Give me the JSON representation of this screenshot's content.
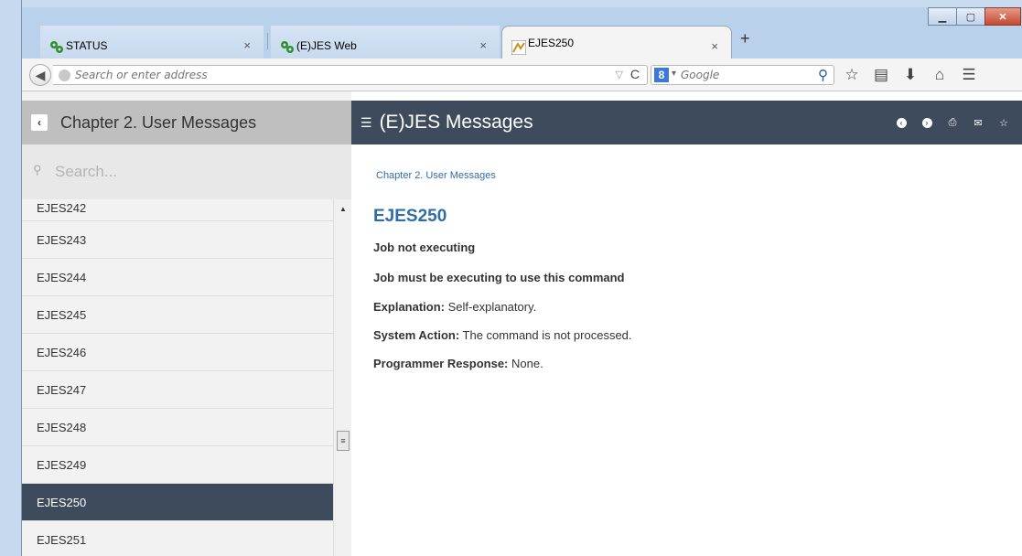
{
  "browser": {
    "tabs": [
      {
        "label": "STATUS",
        "active": false
      },
      {
        "label": "(E)JES Web",
        "active": false
      },
      {
        "label": "EJES250",
        "active": true
      }
    ],
    "tab_close_glyph": "×",
    "new_tab_glyph": "+",
    "address_placeholder": "Search or enter address",
    "search_engine_placeholder": "Google",
    "search_engine_logo": "8",
    "window_buttons": [
      "minimize-icon",
      "maximize-icon",
      "close-icon"
    ],
    "toolbar_icons": [
      "search-icon",
      "bookmark-star-icon",
      "reading-list-icon",
      "download-icon",
      "home-icon",
      "menu-icon"
    ]
  },
  "sidebar": {
    "title": "Chapter 2. User Messages",
    "search_placeholder": "Search...",
    "items": [
      "EJES242",
      "EJES243",
      "EJES244",
      "EJES245",
      "EJES246",
      "EJES247",
      "EJES248",
      "EJES249",
      "EJES250",
      "EJES251"
    ],
    "selected": "EJES250",
    "scroll_position": 0.68
  },
  "main": {
    "title": "(E)JES Messages",
    "breadcrumb": "Chapter 2. User Messages",
    "message_id": "EJES250",
    "short_text": "Job not executing",
    "long_text": "Job must be executing to use this command",
    "explanation_label": "Explanation:",
    "explanation": "Self-explanatory.",
    "system_action_label": "System Action:",
    "system_action": "The command is not processed.",
    "programmer_response_label": "Programmer Response:",
    "programmer_response": "None.",
    "header_actions": [
      "previous-icon",
      "next-icon",
      "print-icon",
      "mail-icon",
      "favorite-star-icon"
    ]
  },
  "colors": {
    "header_dark": "#3d4b5d",
    "link_blue": "#2f6da8",
    "sidebar_header": "#bfbfbf"
  }
}
